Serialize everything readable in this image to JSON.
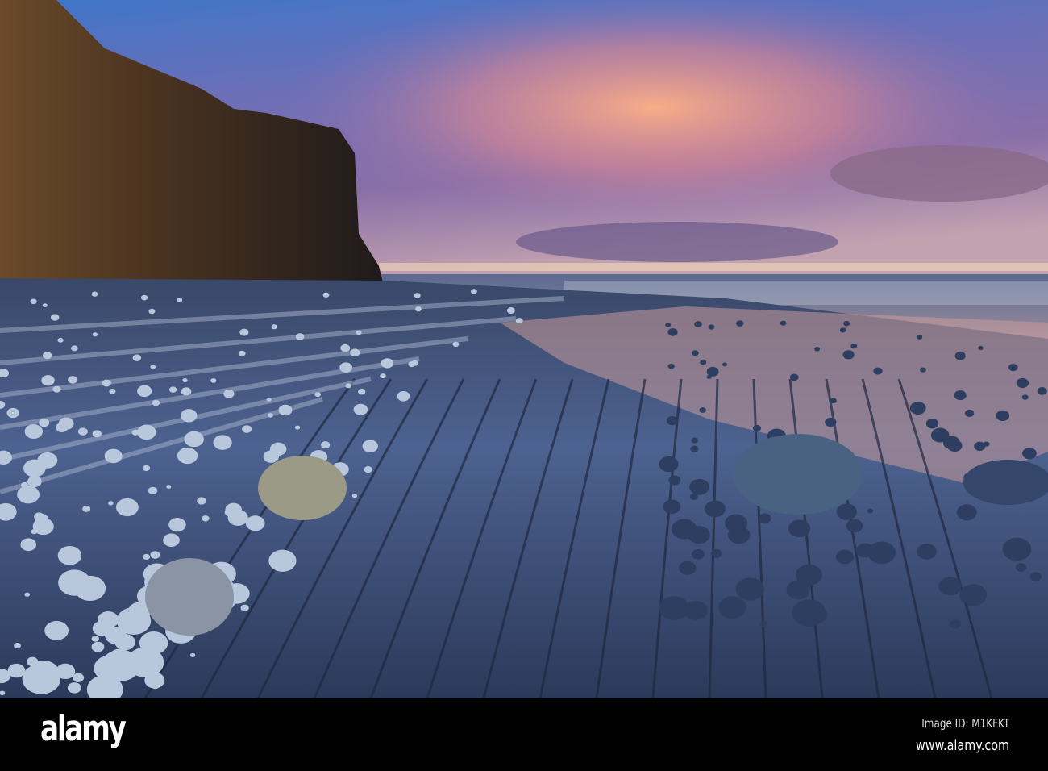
{
  "photo": {
    "subject": "cliff-coast-sunset",
    "watermark": "alamy"
  },
  "footer": {
    "logo": "alamy",
    "image_id": "Image ID: M1KFKT",
    "website": "www.alamy.com"
  },
  "colors": {
    "sky_top": "#3a6fc0",
    "cloud_glow": "#f2a07a",
    "cliff": "#3b2b1f",
    "rock": "#4a5f86",
    "pebble": "#b8c7dc"
  }
}
